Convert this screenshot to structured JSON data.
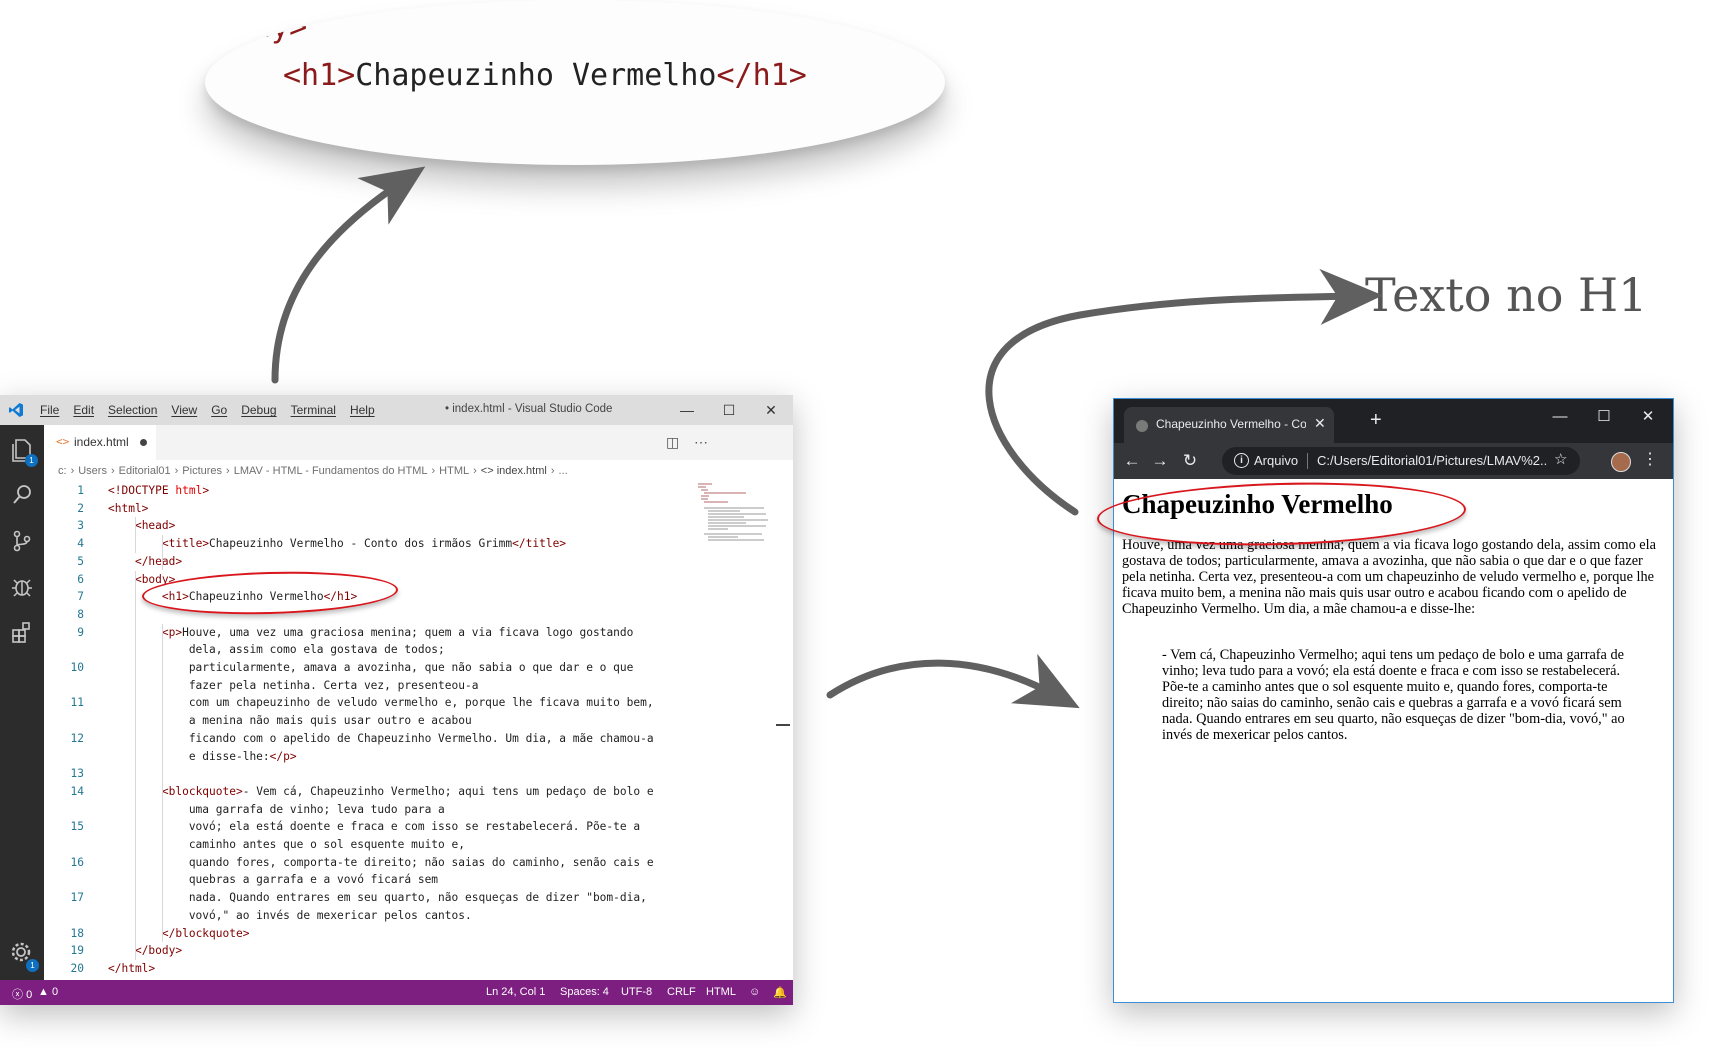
{
  "zoom_bubble": {
    "line1": "ody>",
    "line2_open": "<h1>",
    "line2_text": "Chapeuzinho Vermelho",
    "line2_close": "</h1>"
  },
  "caption": "Texto no H1",
  "colors": {
    "red_ring": "#d8161c",
    "status_bar": "#7d1f80",
    "arrow": "#606060",
    "chrome_frame": "#202124"
  },
  "vscode": {
    "menu": [
      "File",
      "Edit",
      "Selection",
      "View",
      "Go",
      "Debug",
      "Terminal",
      "Help"
    ],
    "title": "• index.html - Visual Studio Code",
    "activity_icons": [
      "explorer-icon",
      "search-icon",
      "source-control-icon",
      "debug-icon",
      "extensions-icon",
      "settings-gear-icon"
    ],
    "explorer_badge": "1",
    "settings_badge": "1",
    "tab": {
      "icon": "<>",
      "label": "index.html"
    },
    "breadcrumb": [
      "c:",
      "Users",
      "Editorial01",
      "Pictures",
      "LMAV - HTML - Fundamentos do HTML",
      "HTML",
      "<> index.html",
      "..."
    ],
    "status": {
      "errors": "0",
      "warnings": "0",
      "position": "Ln 24, Col 1",
      "spaces": "Spaces: 4",
      "encoding": "UTF-8",
      "eol": "CRLF",
      "language": "HTML"
    },
    "code_lines": [
      {
        "n": "1",
        "tokens": [
          {
            "c": "t",
            "v": "<!DOCTYPE "
          },
          {
            "c": "a",
            "v": "html"
          },
          {
            "c": "t",
            "v": ">"
          }
        ]
      },
      {
        "n": "2",
        "tokens": [
          {
            "c": "t",
            "v": "<html>"
          }
        ]
      },
      {
        "n": "3",
        "tokens": [
          {
            "c": "",
            "v": "    "
          },
          {
            "c": "t",
            "v": "<head>"
          }
        ]
      },
      {
        "n": "4",
        "tokens": [
          {
            "c": "",
            "v": "        "
          },
          {
            "c": "t",
            "v": "<title>"
          },
          {
            "c": "",
            "v": "Chapeuzinho Vermelho - Conto dos irmãos Grimm"
          },
          {
            "c": "t",
            "v": "</title>"
          }
        ]
      },
      {
        "n": "5",
        "tokens": [
          {
            "c": "",
            "v": "    "
          },
          {
            "c": "t",
            "v": "</head>"
          }
        ]
      },
      {
        "n": "6",
        "tokens": [
          {
            "c": "",
            "v": "    "
          },
          {
            "c": "t",
            "v": "<body>"
          }
        ]
      },
      {
        "n": "7",
        "tokens": [
          {
            "c": "",
            "v": "        "
          },
          {
            "c": "t",
            "v": "<h1>"
          },
          {
            "c": "",
            "v": "Chapeuzinho Vermelho"
          },
          {
            "c": "t",
            "v": "</h1>"
          }
        ]
      },
      {
        "n": "8",
        "tokens": []
      },
      {
        "n": "9",
        "tokens": [
          {
            "c": "",
            "v": "        "
          },
          {
            "c": "t",
            "v": "<p>"
          },
          {
            "c": "",
            "v": "Houve, uma vez uma graciosa menina; quem a via ficava logo gostando"
          }
        ]
      },
      {
        "n": "",
        "tokens": [
          {
            "c": "",
            "v": "            dela, assim como ela gostava de todos;"
          }
        ]
      },
      {
        "n": "10",
        "tokens": [
          {
            "c": "",
            "v": "            particularmente, amava a avozinha, que não sabia o que dar e o que"
          }
        ]
      },
      {
        "n": "",
        "tokens": [
          {
            "c": "",
            "v": "            fazer pela netinha. Certa vez, presenteou-a"
          }
        ]
      },
      {
        "n": "11",
        "tokens": [
          {
            "c": "",
            "v": "            com um chapeuzinho de veludo vermelho e, porque lhe ficava muito bem,"
          }
        ]
      },
      {
        "n": "",
        "tokens": [
          {
            "c": "",
            "v": "            a menina não mais quis usar outro e acabou"
          }
        ]
      },
      {
        "n": "12",
        "tokens": [
          {
            "c": "",
            "v": "            ficando com o apelido de Chapeuzinho Vermelho. Um dia, a mãe chamou-a"
          }
        ]
      },
      {
        "n": "",
        "tokens": [
          {
            "c": "",
            "v": "            e disse-lhe:"
          },
          {
            "c": "t",
            "v": "</p>"
          }
        ]
      },
      {
        "n": "13",
        "tokens": []
      },
      {
        "n": "14",
        "tokens": [
          {
            "c": "",
            "v": "        "
          },
          {
            "c": "t",
            "v": "<blockquote>"
          },
          {
            "c": "",
            "v": "- Vem cá, Chapeuzinho Vermelho; aqui tens um pedaço de bolo e"
          }
        ]
      },
      {
        "n": "",
        "tokens": [
          {
            "c": "",
            "v": "            uma garrafa de vinho; leva tudo para a"
          }
        ]
      },
      {
        "n": "15",
        "tokens": [
          {
            "c": "",
            "v": "            vovó; ela está doente e fraca e com isso se restabelecerá. Põe-te a"
          }
        ]
      },
      {
        "n": "",
        "tokens": [
          {
            "c": "",
            "v": "            caminho antes que o sol esquente muito e,"
          }
        ]
      },
      {
        "n": "16",
        "tokens": [
          {
            "c": "",
            "v": "            quando fores, comporta-te direito; não saias do caminho, senão cais e"
          }
        ]
      },
      {
        "n": "",
        "tokens": [
          {
            "c": "",
            "v": "            quebras a garrafa e a vovó ficará sem"
          }
        ]
      },
      {
        "n": "17",
        "tokens": [
          {
            "c": "",
            "v": "            nada. Quando entrares em seu quarto, não esqueças de dizer \"bom-dia,"
          }
        ]
      },
      {
        "n": "",
        "tokens": [
          {
            "c": "",
            "v": "            vovó,\" ao invés de mexericar pelos cantos."
          }
        ]
      },
      {
        "n": "18",
        "tokens": [
          {
            "c": "",
            "v": "        "
          },
          {
            "c": "t",
            "v": "</blockquote>"
          }
        ]
      },
      {
        "n": "19",
        "tokens": [
          {
            "c": "",
            "v": "    "
          },
          {
            "c": "t",
            "v": "</body>"
          }
        ]
      },
      {
        "n": "20",
        "tokens": [
          {
            "c": "t",
            "v": "</html>"
          }
        ]
      },
      {
        "n": "21",
        "tokens": []
      }
    ]
  },
  "chrome": {
    "tab_title": "Chapeuzinho Vermelho - Conto dos irmãos Grimm",
    "address_scheme": "Arquivo",
    "address_url": "C:/Users/Editorial01/Pictures/LMAV%2...",
    "page": {
      "h1": "Chapeuzinho Vermelho",
      "paragraph": "Houve, uma vez uma graciosa menina; quem a via ficava logo gostando dela, assim como ela gostava de todos; particularmente, amava a avozinha, que não sabia o que dar e o que fazer pela netinha. Certa vez, presenteou-a com um chapeuzinho de veludo vermelho e, porque lhe ficava muito bem, a menina não mais quis usar outro e acabou ficando com o apelido de Chapeuzinho Vermelho. Um dia, a mãe chamou-a e disse-lhe:",
      "blockquote": "- Vem cá, Chapeuzinho Vermelho; aqui tens um pedaço de bolo e uma garrafa de vinho; leva tudo para a vovó; ela está doente e fraca e com isso se restabelecerá. Põe-te a caminho antes que o sol esquente muito e, quando fores, comporta-te direito; não saias do caminho, senão cais e quebras a garrafa e a vovó ficará sem nada. Quando entrares em seu quarto, não esqueças de dizer \"bom-dia, vovó,\" ao invés de mexericar pelos cantos."
    }
  }
}
